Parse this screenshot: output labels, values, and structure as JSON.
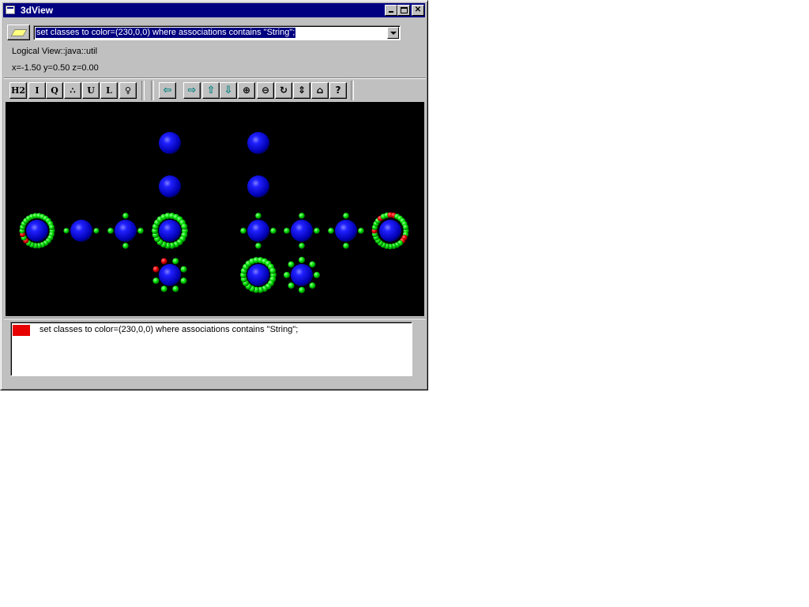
{
  "window": {
    "title": "3dView",
    "minimize_label": "Minimize",
    "maximize_label": "Maximize",
    "close_label": "✕"
  },
  "query": {
    "command_icon": "pencil-icon",
    "current_value": "set classes to color=(230,0,0) where associations contains \"String\";"
  },
  "info": {
    "path": "Logical View::java::util",
    "coords": "x=-1.50 y=0.50 z=0.00"
  },
  "toolbar": {
    "buttons": [
      {
        "label": "H2",
        "icon": "h2-icon"
      },
      {
        "label": "I",
        "icon": "i-icon"
      },
      {
        "label": "Q",
        "icon": "q-icon"
      },
      {
        "label": "∴",
        "icon": "grid-dots-icon"
      },
      {
        "label": "U",
        "icon": "u-icon"
      },
      {
        "label": "L",
        "icon": "l-icon"
      },
      {
        "label": "♀",
        "icon": "pin-icon"
      },
      {
        "label": "⇦",
        "icon": "arrow-left-icon"
      },
      {
        "label": "⇨",
        "icon": "arrow-right-icon"
      },
      {
        "label": "⇧",
        "icon": "arrow-up-icon"
      },
      {
        "label": "⇩",
        "icon": "arrow-down-icon"
      },
      {
        "label": "⊕",
        "icon": "zoom-in-icon"
      },
      {
        "label": "⊖",
        "icon": "zoom-out-icon"
      },
      {
        "label": "↻",
        "icon": "rotate-icon"
      },
      {
        "label": "⇕",
        "icon": "tilt-icon"
      },
      {
        "label": "⌂",
        "icon": "home-icon"
      },
      {
        "label": "?",
        "icon": "help-icon"
      }
    ]
  },
  "colors": {
    "sphere_blue": "#0000ff",
    "attribute_green": "#00e000",
    "highlight_red": "#e60000",
    "viewport_bg": "#000000",
    "titlebar": "#000080"
  },
  "log": {
    "entries": [
      {
        "swatch_color": "#e60000",
        "text": "set classes to color=(230,0,0) where associations contains \"String\";"
      }
    ]
  }
}
